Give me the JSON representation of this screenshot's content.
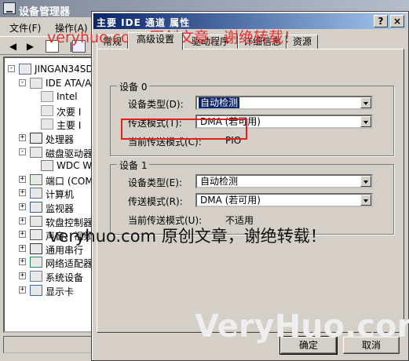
{
  "device_manager": {
    "title": "设备管理器",
    "menu": [
      "文件(F)",
      "操作(A)"
    ],
    "tree": [
      {
        "label": "JINGAN34SD",
        "level": 0,
        "expander": "-",
        "icon": "computer-icon"
      },
      {
        "label": "IDE ATA/A",
        "level": 1,
        "expander": "-",
        "icon": "ide-controller-icon"
      },
      {
        "label": "Intel",
        "level": 2,
        "expander": "",
        "icon": "controller-chip-icon"
      },
      {
        "label": "次要 I",
        "level": 2,
        "expander": "",
        "icon": "controller-chip-icon"
      },
      {
        "label": "主要 I",
        "level": 2,
        "expander": "",
        "icon": "controller-chip-icon"
      },
      {
        "label": "处理器",
        "level": 1,
        "expander": "+",
        "icon": "processor-icon"
      },
      {
        "label": "磁盘驱动器",
        "level": 1,
        "expander": "-",
        "icon": "disk-drive-icon"
      },
      {
        "label": "WDC WD",
        "level": 2,
        "expander": "",
        "icon": "disk-drive-icon"
      },
      {
        "label": "端口 (COM",
        "level": 1,
        "expander": "+",
        "icon": "port-icon"
      },
      {
        "label": "计算机",
        "level": 1,
        "expander": "+",
        "icon": "computer-icon"
      },
      {
        "label": "监视器",
        "level": 1,
        "expander": "+",
        "icon": "monitor-icon"
      },
      {
        "label": "软盘控制器",
        "level": 1,
        "expander": "+",
        "icon": "floppy-controller-icon"
      },
      {
        "label": "声音、视频",
        "level": 1,
        "expander": "+",
        "icon": "sound-icon"
      },
      {
        "label": "通用串行",
        "level": 1,
        "expander": "+",
        "icon": "usb-icon"
      },
      {
        "label": "网络适配器",
        "level": 1,
        "expander": "+",
        "icon": "network-adapter-icon"
      },
      {
        "label": "系统设备",
        "level": 1,
        "expander": "+",
        "icon": "system-device-icon"
      },
      {
        "label": "显示卡",
        "level": 1,
        "expander": "+",
        "icon": "display-adapter-icon"
      }
    ]
  },
  "dialog": {
    "title": "主要 IDE 通道 属性",
    "help_glyph": "?",
    "close_glyph": "×",
    "tabs": [
      "常规",
      "高级设置",
      "驱动程序",
      "详细信息",
      "资源"
    ],
    "active_tab": 1,
    "device0": {
      "group_title": "设备 0",
      "type_label": "设备类型(D):",
      "type_value": "自动检测",
      "mode_label": "传送模式(T):",
      "mode_value": "DMA (若可用)",
      "current_label": "当前传送模式(C):",
      "current_value": "PIO"
    },
    "device1": {
      "group_title": "设备 1",
      "type_label": "设备类型(E):",
      "type_value": "自动检测",
      "mode_label": "传送模式(R):",
      "mode_value": "DMA (若可用)",
      "current_label": "当前传送模式(U):",
      "current_value": "不适用"
    },
    "ok_label": "确定",
    "cancel_label": "取消"
  },
  "watermarks": {
    "top": "veryhuo.com 原创文章，谢绝转载！",
    "middle": "veryhuo.com 原创文章，谢绝转载！",
    "logo": "VeryHuo.com"
  },
  "colors": {
    "title_active": "#0a246a",
    "highlight_box": "#e0201e",
    "watermark_red": "#e23333"
  }
}
